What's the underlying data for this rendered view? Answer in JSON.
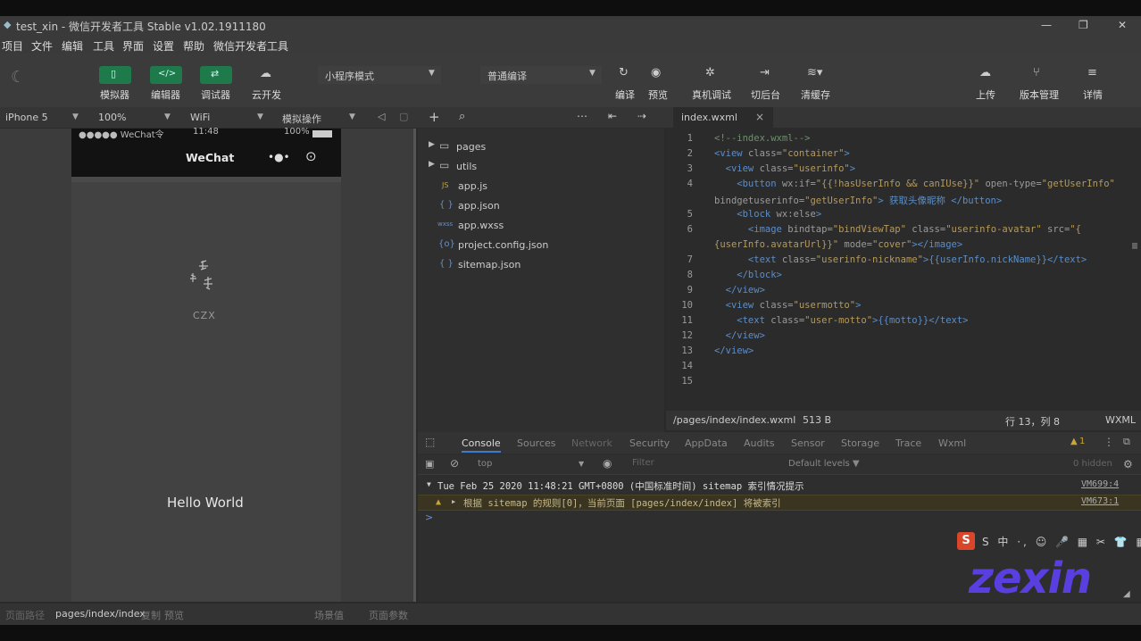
{
  "window": {
    "title": "test_xin - 微信开发者工具 Stable v1.02.1911180",
    "minimize": "—",
    "maximize": "❐",
    "close": "✕"
  },
  "menu": [
    "项目",
    "文件",
    "编辑",
    "工具",
    "界面",
    "设置",
    "帮助",
    "微信开发者工具"
  ],
  "toolbar": {
    "simulator": "模拟器",
    "editor": "编辑器",
    "debugger": "调试器",
    "cloud": "云开发",
    "mode_select": "小程序模式",
    "compile_select": "普通编译",
    "compile": "编译",
    "preview": "预览",
    "remote_debug": "真机调试",
    "background": "切后台",
    "clear_cache": "清缓存",
    "upload": "上传",
    "version": "版本管理",
    "details": "详情"
  },
  "subbar": {
    "device": "iPhone 5",
    "zoom": "100%",
    "network": "WiFi",
    "operation": "模拟操作"
  },
  "simulator": {
    "status_left": "●●●●● WeChat令",
    "status_time": "11:48",
    "status_right": "100%",
    "nav_title": "WeChat",
    "nav_more": "•●•",
    "logo_text": "CZX",
    "hello": "Hello World"
  },
  "tree": {
    "items": [
      {
        "icon": "▶ ▭",
        "label": "pages"
      },
      {
        "icon": "▶ ▭",
        "label": "utils"
      },
      {
        "icon": "JS",
        "label": "app.js"
      },
      {
        "icon": "{ }",
        "label": "app.json"
      },
      {
        "icon": "wxss",
        "label": "app.wxss"
      },
      {
        "icon": "{o}",
        "label": "project.config.json"
      },
      {
        "icon": "{ }",
        "label": "sitemap.json"
      }
    ]
  },
  "editor": {
    "tab_label": "index.wxml",
    "tab_close": "×",
    "status_path": "/pages/index/index.wxml",
    "status_size": "513 B",
    "status_pos": "行 13，列 8",
    "status_lang": "WXML"
  },
  "code": {
    "l1": "<!--index.wxml-->",
    "l2a": "<view ",
    "l2b": "class=",
    "l2c": "\"container\"",
    "l2d": ">",
    "l3a": "  <view ",
    "l3b": "class=",
    "l3c": "\"userinfo\"",
    "l3d": ">",
    "l4a": "    <button ",
    "l4b": "wx:if=",
    "l4c": "\"{{!hasUserInfo && canIUse}}\"",
    "l4d": " open-type=",
    "l4e": "\"getUserInfo\"",
    "l4f": "bindgetuserinfo=",
    "l4g": "\"getUserInfo\"",
    "l4h": "> 获取头像昵称 </button>",
    "l5a": "    <block ",
    "l5b": "wx:else",
    "l5c": ">",
    "l6a": "      <image ",
    "l6b": "bindtap=",
    "l6c": "\"bindViewTap\"",
    "l6d": " class=",
    "l6e": "\"userinfo-avatar\"",
    "l6f": " src=",
    "l6g": "\"{",
    "l6h": "{userInfo.avatarUrl}}\"",
    "l6i": " mode=",
    "l6j": "\"cover\"",
    "l6k": "></image>",
    "l7a": "      <text ",
    "l7b": "class=",
    "l7c": "\"userinfo-nickname\"",
    "l7d": ">{{userInfo.nickName}}</text>",
    "l8": "    </block>",
    "l9": "  </view>",
    "l10a": "  <view ",
    "l10b": "class=",
    "l10c": "\"usermotto\"",
    "l10d": ">",
    "l11a": "    <text ",
    "l11b": "class=",
    "l11c": "\"user-motto\"",
    "l11d": ">{{motto}}</text>",
    "l12": "  </view>",
    "l13": "</view>",
    "nums": [
      "1",
      "2",
      "3",
      "4",
      "5",
      "6",
      "7",
      "8",
      "9",
      "10",
      "11",
      "12",
      "13",
      "14",
      "15"
    ]
  },
  "devtools": {
    "tabs": [
      "Console",
      "Sources",
      "Network",
      "Security",
      "AppData",
      "Audits",
      "Sensor",
      "Storage",
      "Trace",
      "Wxml"
    ],
    "warn_count": "1",
    "context": "top",
    "filter_placeholder": "Filter",
    "levels": "Default levels ▼",
    "hidden": "0 hidden",
    "log1": "Tue Feb 25 2020 11:48:21 GMT+0800 (中国标准时间) sitemap 索引情况提示",
    "log1_src": "VM699:4",
    "log2": "根据 sitemap 的规则[0]，当前页面 [pages/index/index] 将被索引",
    "log2_src": "VM673:1",
    "prompt": ">"
  },
  "bottom": {
    "label": "页面路径",
    "path": "pages/index/index",
    "copy": "复制",
    "open": "预览",
    "params": "场景值",
    "page_params": "页面参数"
  },
  "watermark": {
    "ime": "S 中 ·, ☺ 🎤 ▦ ✂ 👕 ▦",
    "logo": "zexin"
  },
  "colors": {
    "accent": "#1f7a4b",
    "watermark": "#5a3fe0"
  }
}
